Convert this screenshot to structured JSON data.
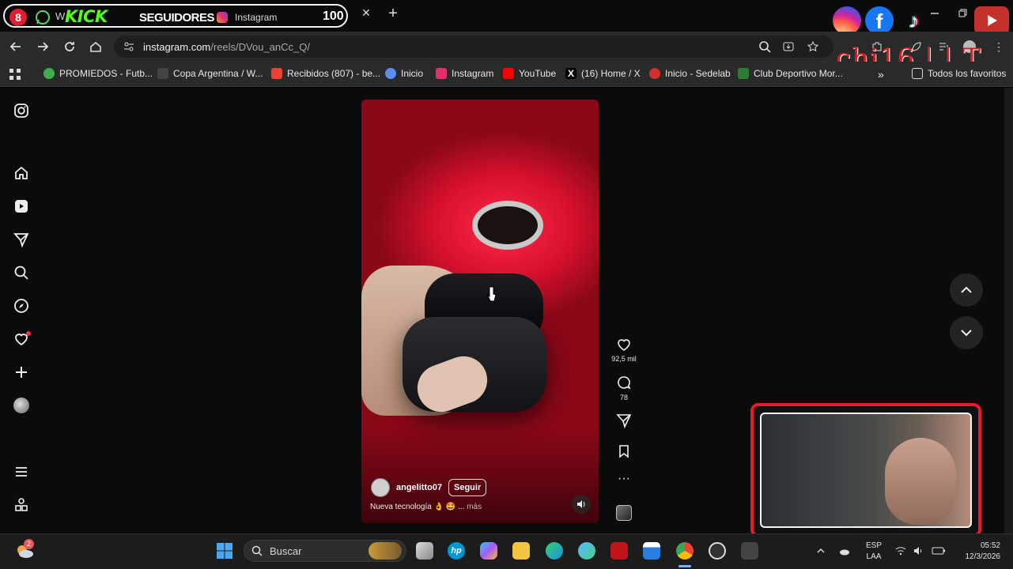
{
  "browser": {
    "tab": {
      "title": "Instagram"
    },
    "stream_overlay": {
      "badge": "8",
      "w_text": "W",
      "kick": "KICK",
      "seguidores": "SEGUIDORES",
      "count": "100"
    },
    "address": {
      "host": "instagram.com",
      "path": "/reels/DVou_anCc_Q/"
    },
    "bookmarks": [
      {
        "label": "PROMIEDOS - Futb...",
        "color": "#3fae49"
      },
      {
        "label": "Copa Argentina / W...",
        "color": "#444444"
      },
      {
        "label": "Recibidos (807) - be...",
        "color": "#ea4335"
      },
      {
        "label": "Inicio",
        "color": "#5b8def"
      },
      {
        "label": "Instagram",
        "color": "#e1306c"
      },
      {
        "label": "YouTube",
        "color": "#ff0000"
      },
      {
        "label": "(16) Home / X",
        "color": "#000000"
      },
      {
        "label": "Inicio - Sedelab",
        "color": "#d32f2f"
      },
      {
        "label": "Club Deportivo Mor...",
        "color": "#2e7d32"
      }
    ],
    "all_bookmarks": "Todos los favoritos"
  },
  "overlay": {
    "watermark": "chi16 | | T"
  },
  "sidebar": {
    "icons": [
      "instagram-logo-icon",
      "home-icon",
      "reels-icon",
      "messages-icon",
      "search-icon",
      "explore-icon",
      "notifications-icon",
      "create-icon",
      "profile-avatar-icon",
      "menu-icon",
      "more-apps-icon"
    ]
  },
  "reel": {
    "username": "angelitto07",
    "follow_label": "Seguir",
    "caption": "Nueva tecnología 👌 🤩 ...",
    "caption_more": "más",
    "likes": "92,5 mil",
    "comments": "78"
  },
  "taskbar": {
    "weather_badge": "2",
    "search_placeholder": "Buscar",
    "lang_top": "ESP",
    "lang_bottom": "LAA",
    "time": "05:52",
    "date": "12/3/2026"
  },
  "colors": {
    "accent_red": "#e61c2a",
    "kick_green": "#53fc18",
    "instagram": "#e1306c"
  }
}
